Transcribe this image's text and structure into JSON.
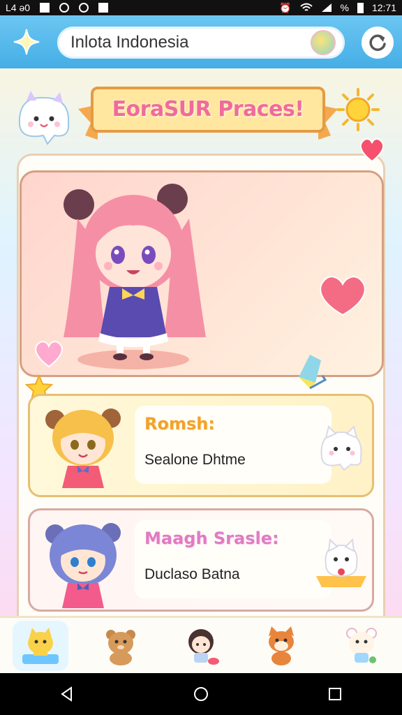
{
  "status_bar": {
    "left_text": "L4 ǝ0",
    "time": "12:71",
    "battery_text": "%"
  },
  "header": {
    "search_value": "Inlota Indonesia"
  },
  "banner": {
    "title": "EoraSUR Praces!"
  },
  "cards": [
    {
      "title": "Romsh:",
      "subtitle": "Sealone Dhtme"
    },
    {
      "title": "Maagh Srasle:",
      "subtitle": "Duclaso Batna"
    }
  ],
  "tabs": [
    {
      "icon": "cat-character-icon"
    },
    {
      "icon": "bear-character-icon"
    },
    {
      "icon": "girl-character-icon"
    },
    {
      "icon": "fox-character-icon"
    },
    {
      "icon": "bunny-character-icon"
    }
  ],
  "colors": {
    "topbar": "#45aee6",
    "banner_text": "#f06b9c",
    "card1_title": "#f2a22d",
    "card2_title": "#e07cc2"
  }
}
